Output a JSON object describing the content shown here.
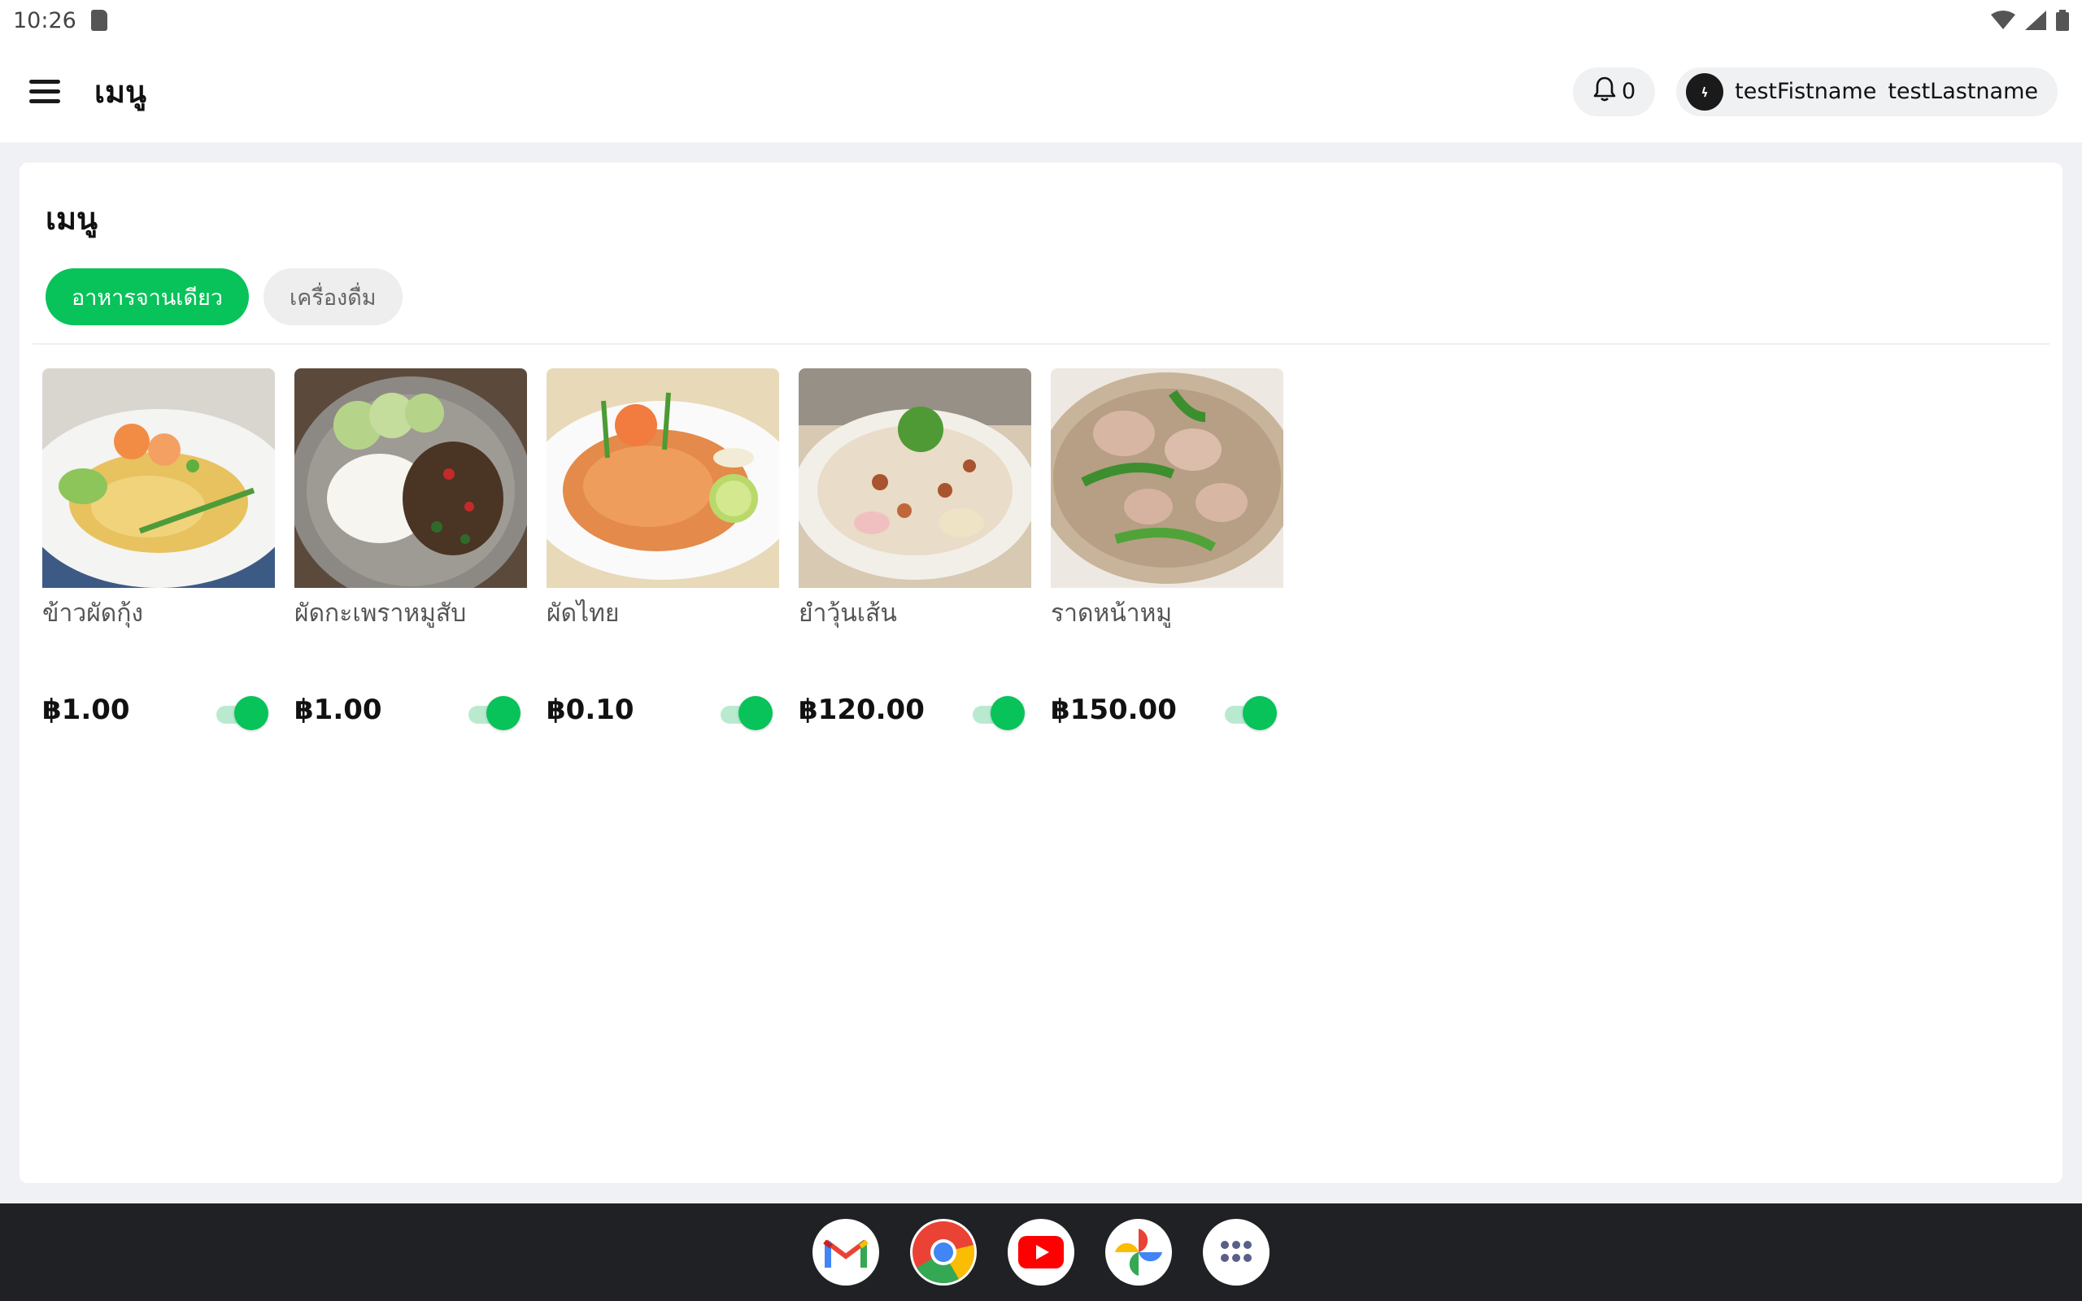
{
  "status_bar": {
    "time": "10:26"
  },
  "app_bar": {
    "title": "เมนู",
    "notification_count": "0",
    "user_first_name": "testFistname",
    "user_last_name": "testLastname"
  },
  "section": {
    "title": "เมนู",
    "tabs": [
      {
        "label": "อาหารจานเดียว",
        "active": true
      },
      {
        "label": "เครื่องดื่ม",
        "active": false
      }
    ]
  },
  "menu_items": [
    {
      "name": "ข้าวผัดกุ้ง",
      "price": "฿1.00",
      "available": true,
      "image": "fried-rice-shrimp"
    },
    {
      "name": "ผัดกะเพราหมูสับ",
      "price": "฿1.00",
      "available": true,
      "image": "basil-pork-rice"
    },
    {
      "name": "ผัดไทย",
      "price": "฿0.10",
      "available": true,
      "image": "pad-thai"
    },
    {
      "name": "ยำวุ้นเส้น",
      "price": "฿120.00",
      "available": true,
      "image": "glass-noodle-salad"
    },
    {
      "name": "ราดหน้าหมู",
      "price": "฿150.00",
      "available": true,
      "image": "rad-na-pork"
    }
  ],
  "dock_apps": [
    "gmail-icon",
    "chrome-icon",
    "youtube-icon",
    "photos-icon",
    "app-drawer-icon"
  ],
  "colors": {
    "accent": "#07c35a",
    "accent_light": "#b9ead0",
    "background": "#f0f1f4",
    "dock": "#202124"
  }
}
